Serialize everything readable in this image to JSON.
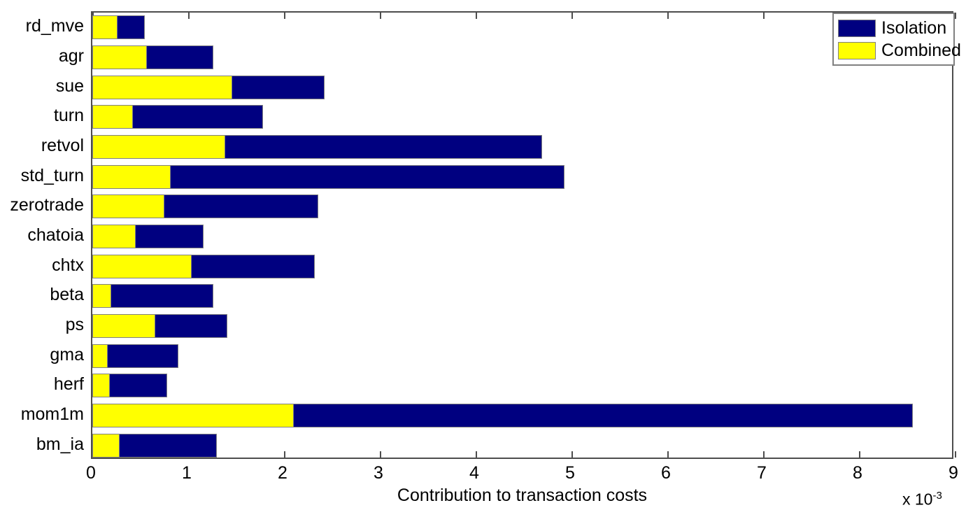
{
  "chart_data": {
    "type": "bar",
    "orientation": "horizontal",
    "stacked": true,
    "title": "",
    "xlabel": "Contribution to transaction costs",
    "ylabel": "",
    "x_exponent_label": "x 10",
    "x_exponent_power": "-3",
    "xlim": [
      0,
      9
    ],
    "xticks": [
      0,
      1,
      2,
      3,
      4,
      5,
      6,
      7,
      8,
      9
    ],
    "xticklabels": [
      "0",
      "1",
      "2",
      "3",
      "4",
      "5",
      "6",
      "7",
      "8",
      "9"
    ],
    "grid": false,
    "legend_position": "top-right",
    "categories": [
      "rd_mve",
      "agr",
      "sue",
      "turn",
      "retvol",
      "std_turn",
      "zerotrade",
      "chatoia",
      "chtx",
      "beta",
      "ps",
      "gma",
      "herf",
      "mom1m",
      "bm_ia"
    ],
    "series": [
      {
        "name": "Isolation",
        "color": "#000080",
        "note": "total bar length (outer, stacked behind Combined)",
        "values": [
          0.55,
          1.26,
          2.42,
          1.78,
          4.69,
          4.93,
          2.36,
          1.16,
          2.32,
          1.26,
          1.41,
          0.9,
          0.78,
          8.56,
          1.3
        ]
      },
      {
        "name": "Combined",
        "color": "#ffff00",
        "note": "inner segment length drawn from zero",
        "values": [
          0.26,
          0.57,
          1.46,
          0.42,
          1.39,
          0.82,
          0.75,
          0.45,
          1.04,
          0.2,
          0.66,
          0.16,
          0.18,
          2.1,
          0.285
        ]
      }
    ]
  },
  "legend": {
    "items": [
      {
        "label": "Isolation",
        "color": "#000080"
      },
      {
        "label": "Combined",
        "color": "#ffff00"
      }
    ]
  },
  "colors": {
    "isolation": "#000080",
    "combined": "#ffff00",
    "axis": "#4d4d4d",
    "bar_edge": "#808080",
    "background": "#ffffff",
    "text": "#000000"
  }
}
